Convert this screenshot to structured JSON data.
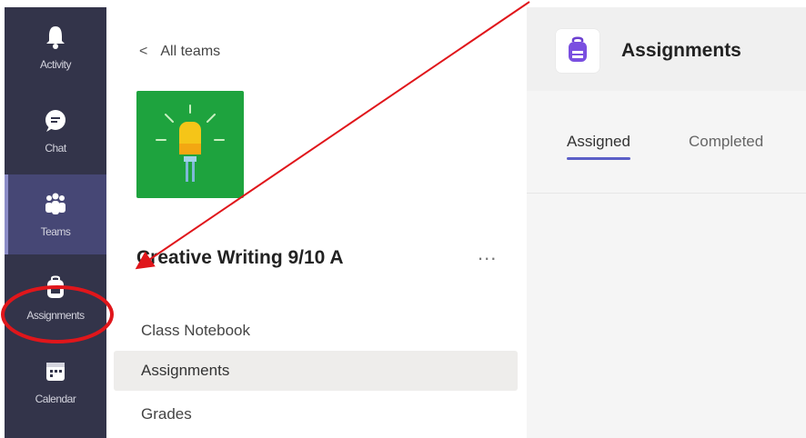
{
  "rail": {
    "items": [
      {
        "label": "Activity",
        "icon": "bell-icon"
      },
      {
        "label": "Chat",
        "icon": "chat-icon"
      },
      {
        "label": "Teams",
        "icon": "teams-icon"
      },
      {
        "label": "Assignments",
        "icon": "backpack-icon"
      },
      {
        "label": "Calendar",
        "icon": "calendar-icon"
      }
    ]
  },
  "team_panel": {
    "back_label": "All teams",
    "team_name": "Creative Writing 9/10 A",
    "more_label": "...",
    "nav": [
      "Class Notebook",
      "Assignments",
      "Grades"
    ]
  },
  "main": {
    "title": "Assignments",
    "tabs": [
      "Assigned",
      "Completed"
    ]
  },
  "colors": {
    "rail_bg": "#33344a",
    "rail_active": "#464775",
    "team_tile": "#1ea33e",
    "accent": "#5b5fc7",
    "annotation": "#e0161b"
  }
}
